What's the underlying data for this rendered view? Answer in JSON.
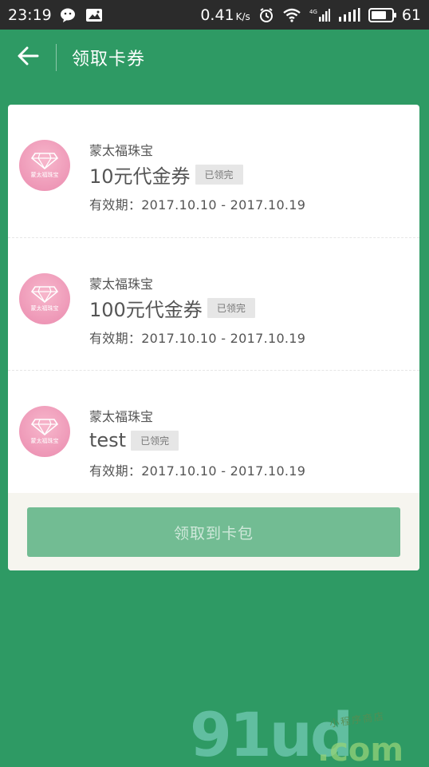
{
  "status_bar": {
    "time": "23:19",
    "speed": "0.41",
    "speed_unit": "K/s",
    "network": "4G",
    "battery": "61",
    "icons": [
      "wechat-icon",
      "image-icon",
      "alarm-icon",
      "wifi-icon",
      "signal-4g-icon",
      "signal-icon",
      "battery-icon"
    ]
  },
  "header": {
    "title": "领取卡券",
    "back_icon": "arrow-left-icon"
  },
  "coupons": [
    {
      "merchant": "蒙太福珠宝",
      "title": "10元代金券",
      "badge": "已领完",
      "validity": "有效期：2017.10.10 - 2017.10.19",
      "logo_text": "蒙太福珠宝"
    },
    {
      "merchant": "蒙太福珠宝",
      "title": "100元代金券",
      "badge": "已领完",
      "validity": "有效期：2017.10.10 - 2017.10.19",
      "logo_text": "蒙太福珠宝"
    },
    {
      "merchant": "蒙太福珠宝",
      "title": "test",
      "badge": "已领完",
      "validity": "有效期：2017.10.10 - 2017.10.19",
      "logo_text": "蒙太福珠宝"
    }
  ],
  "footer": {
    "claim_label": "领取到卡包"
  },
  "watermark": {
    "main": "91ud",
    "suffix": ".com",
    "tagline": "小程序商店"
  },
  "colors": {
    "background": "#2e9a64",
    "button": "#72bc93",
    "badge": "#e6e6e6",
    "logo": "#ee98b7"
  }
}
